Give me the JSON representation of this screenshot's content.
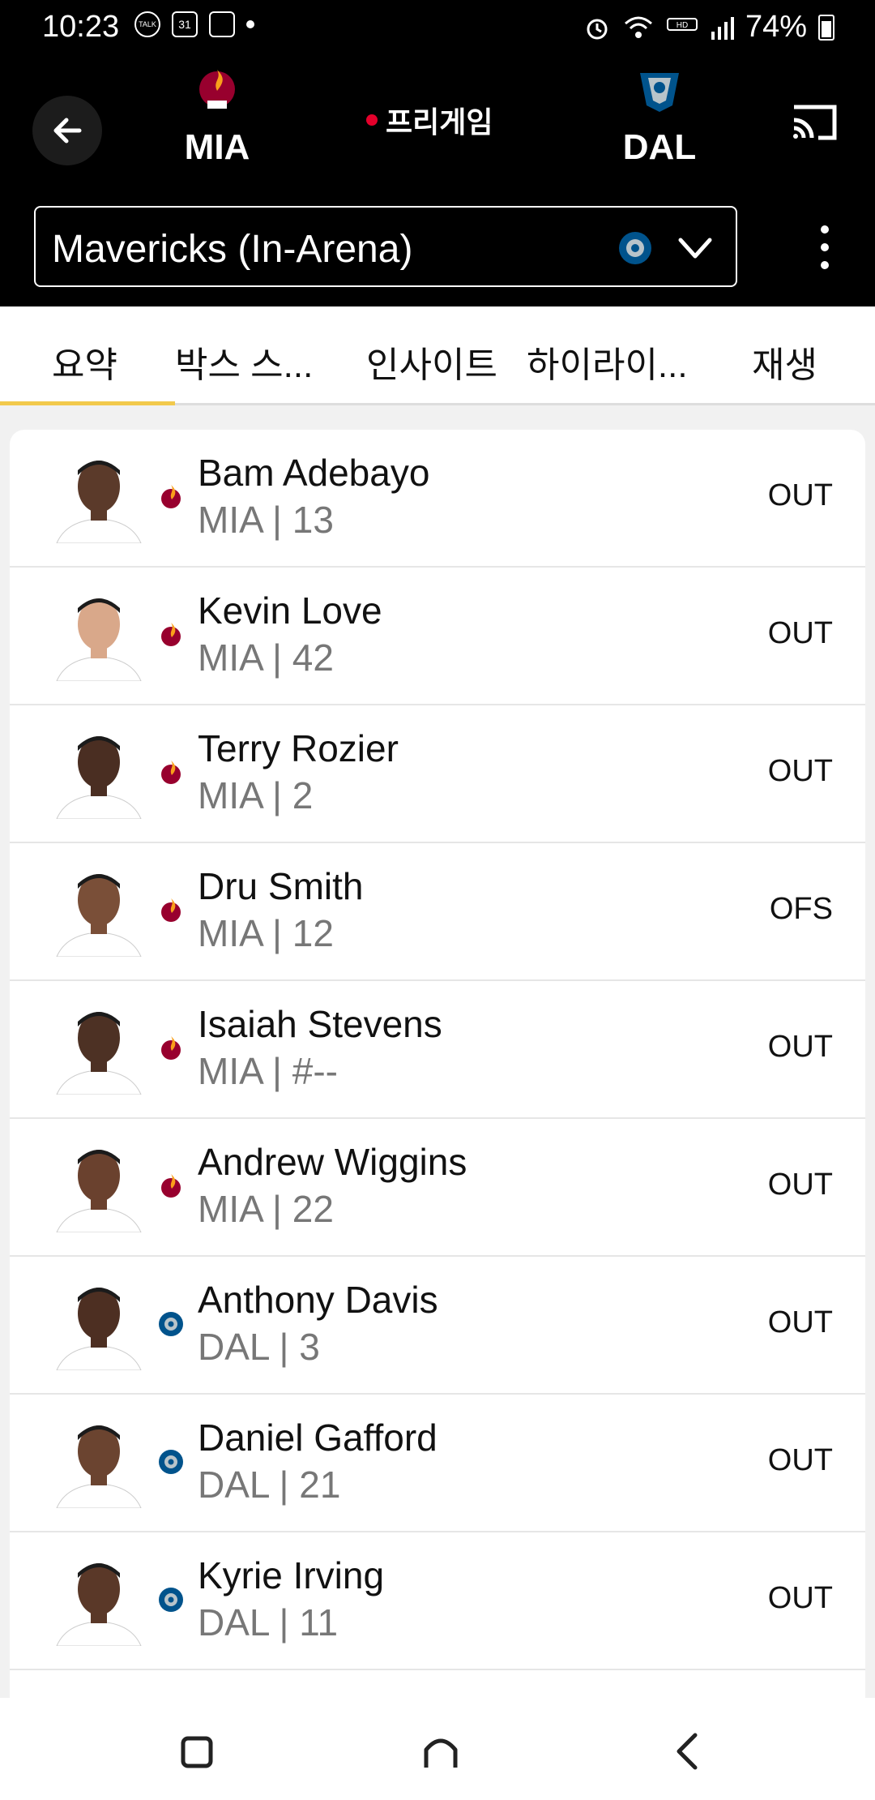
{
  "status_bar": {
    "time": "10:23",
    "left_icons": [
      "talk-icon",
      "calendar-icon",
      "photo-icon"
    ],
    "calendar_text": "31",
    "talk_text": "TALK",
    "battery_text": "74%"
  },
  "header": {
    "home_team": "MIA",
    "away_team": "DAL",
    "game_status": "프리게임",
    "feed_label": "Mavericks (In-Arena)"
  },
  "tabs": [
    {
      "label": "요약"
    },
    {
      "label": "박스 스..."
    },
    {
      "label": "인사이트"
    },
    {
      "label": "하이라이..."
    },
    {
      "label": "재생"
    }
  ],
  "players": [
    {
      "name": "Bam Adebayo",
      "meta": "MIA | 13",
      "status": "OUT",
      "team": "MIA",
      "skin": "#5b3a2a"
    },
    {
      "name": "Kevin Love",
      "meta": "MIA | 42",
      "status": "OUT",
      "team": "MIA",
      "skin": "#d9a88a"
    },
    {
      "name": "Terry Rozier",
      "meta": "MIA | 2",
      "status": "OUT",
      "team": "MIA",
      "skin": "#4a2e22"
    },
    {
      "name": "Dru Smith",
      "meta": "MIA | 12",
      "status": "OFS",
      "team": "MIA",
      "skin": "#7a4f38"
    },
    {
      "name": "Isaiah Stevens",
      "meta": "MIA | #--",
      "status": "OUT",
      "team": "MIA",
      "skin": "#4d3124"
    },
    {
      "name": "Andrew Wiggins",
      "meta": "MIA | 22",
      "status": "OUT",
      "team": "MIA",
      "skin": "#6a412e"
    },
    {
      "name": "Anthony Davis",
      "meta": "DAL | 3",
      "status": "OUT",
      "team": "DAL",
      "skin": "#4d2f22"
    },
    {
      "name": "Daniel Gafford",
      "meta": "DAL | 21",
      "status": "OUT",
      "team": "DAL",
      "skin": "#6b4430"
    },
    {
      "name": "Kyrie Irving",
      "meta": "DAL | 11",
      "status": "OUT",
      "team": "DAL",
      "skin": "#5a3828"
    }
  ],
  "colors": {
    "heat_red": "#98002e",
    "mavs_blue": "#00538c",
    "tab_indicator": "#f2c94c",
    "live_dot": "#e4002b"
  }
}
